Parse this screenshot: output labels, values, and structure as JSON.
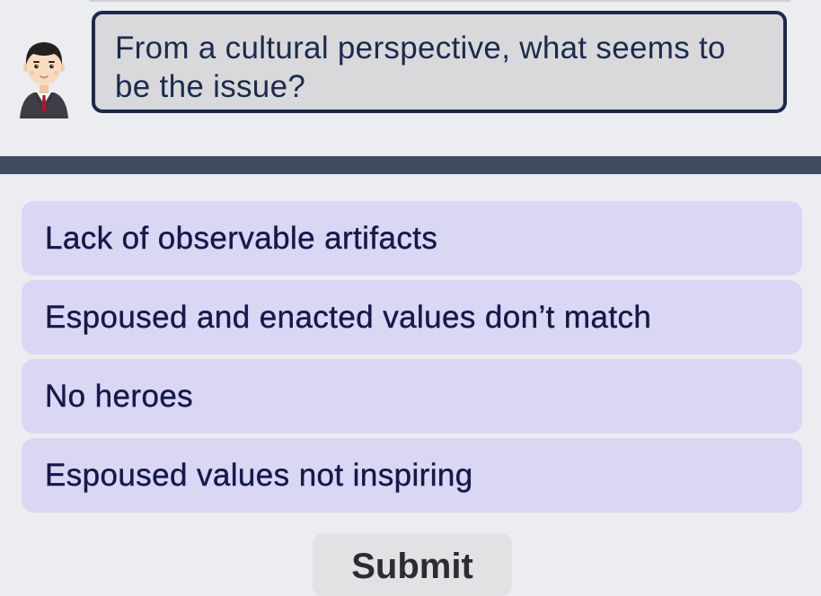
{
  "prompt": {
    "question": "From a cultural perspective, what seems to be the issue?"
  },
  "options": [
    {
      "label": "Lack of observable artifacts"
    },
    {
      "label": "Espoused and enacted values don’t match"
    },
    {
      "label": "No heroes"
    },
    {
      "label": "Espoused values not inspiring"
    }
  ],
  "submit": {
    "label": "Submit"
  },
  "colors": {
    "background": "#ecedf0",
    "bubble_fill": "#d9d9db",
    "bubble_border": "#1c2a4e",
    "divider": "#404a60",
    "option_fill": "#d9d7f4",
    "option_text": "#15194a"
  }
}
